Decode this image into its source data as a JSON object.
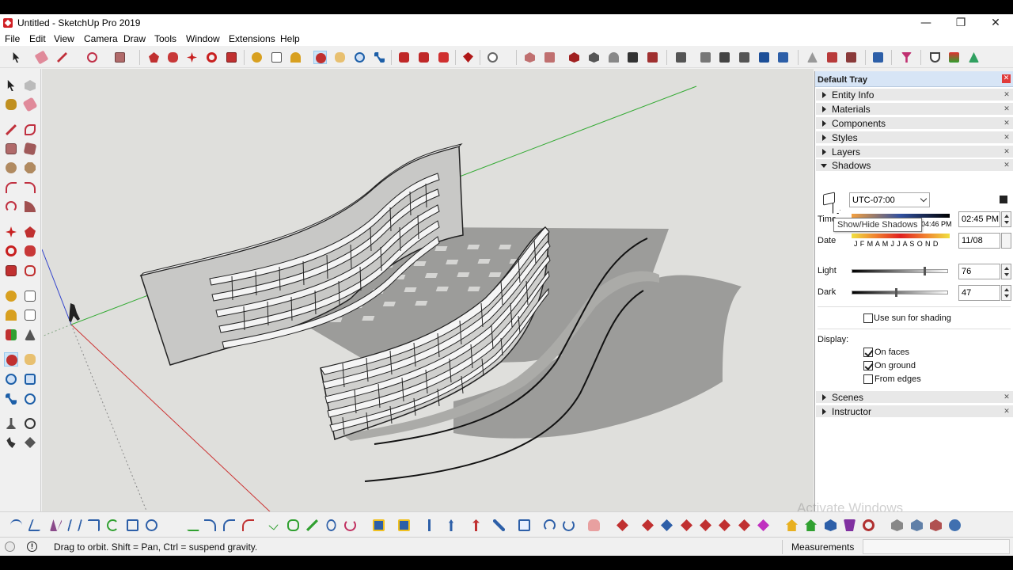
{
  "window": {
    "title": "Untitled - SketchUp Pro 2019",
    "minimize": "—",
    "maximize": "❐",
    "close": "✕"
  },
  "menu": [
    "File",
    "Edit",
    "View",
    "Camera",
    "Draw",
    "Tools",
    "Window",
    "Extensions",
    "Help"
  ],
  "tray": {
    "title": "Default Tray",
    "panels_top": [
      "Entity Info",
      "Materials",
      "Components",
      "Styles",
      "Layers"
    ],
    "shadows": {
      "label": "Shadows",
      "timezone": "UTC-07:00",
      "tooltip": "Show/Hide Shadows",
      "time_label": "Time",
      "time_end_label": "04:46 PM",
      "time_value": "02:45 PM",
      "date_label": "Date",
      "months": "J F M A M J J A S O N D",
      "date_value": "11/08",
      "light_label": "Light",
      "light_value": "76",
      "dark_label": "Dark",
      "dark_value": "47",
      "use_sun": "Use sun for shading",
      "display_label": "Display:",
      "on_faces": "On faces",
      "on_ground": "On ground",
      "from_edges": "From edges"
    },
    "panels_bottom": [
      "Scenes",
      "Instructor"
    ]
  },
  "status": {
    "hint": "Drag to orbit. Shift = Pan, Ctrl = suspend gravity.",
    "measurements_label": "Measurements"
  },
  "watermark": "Activate Windows",
  "colors": {
    "accent": "#d01f24",
    "tray_header": "#d7e5f6",
    "viewport_bg": "#dfdfdc",
    "axis_red": "#cc3333",
    "axis_green": "#33aa33",
    "axis_blue": "#3344cc"
  }
}
